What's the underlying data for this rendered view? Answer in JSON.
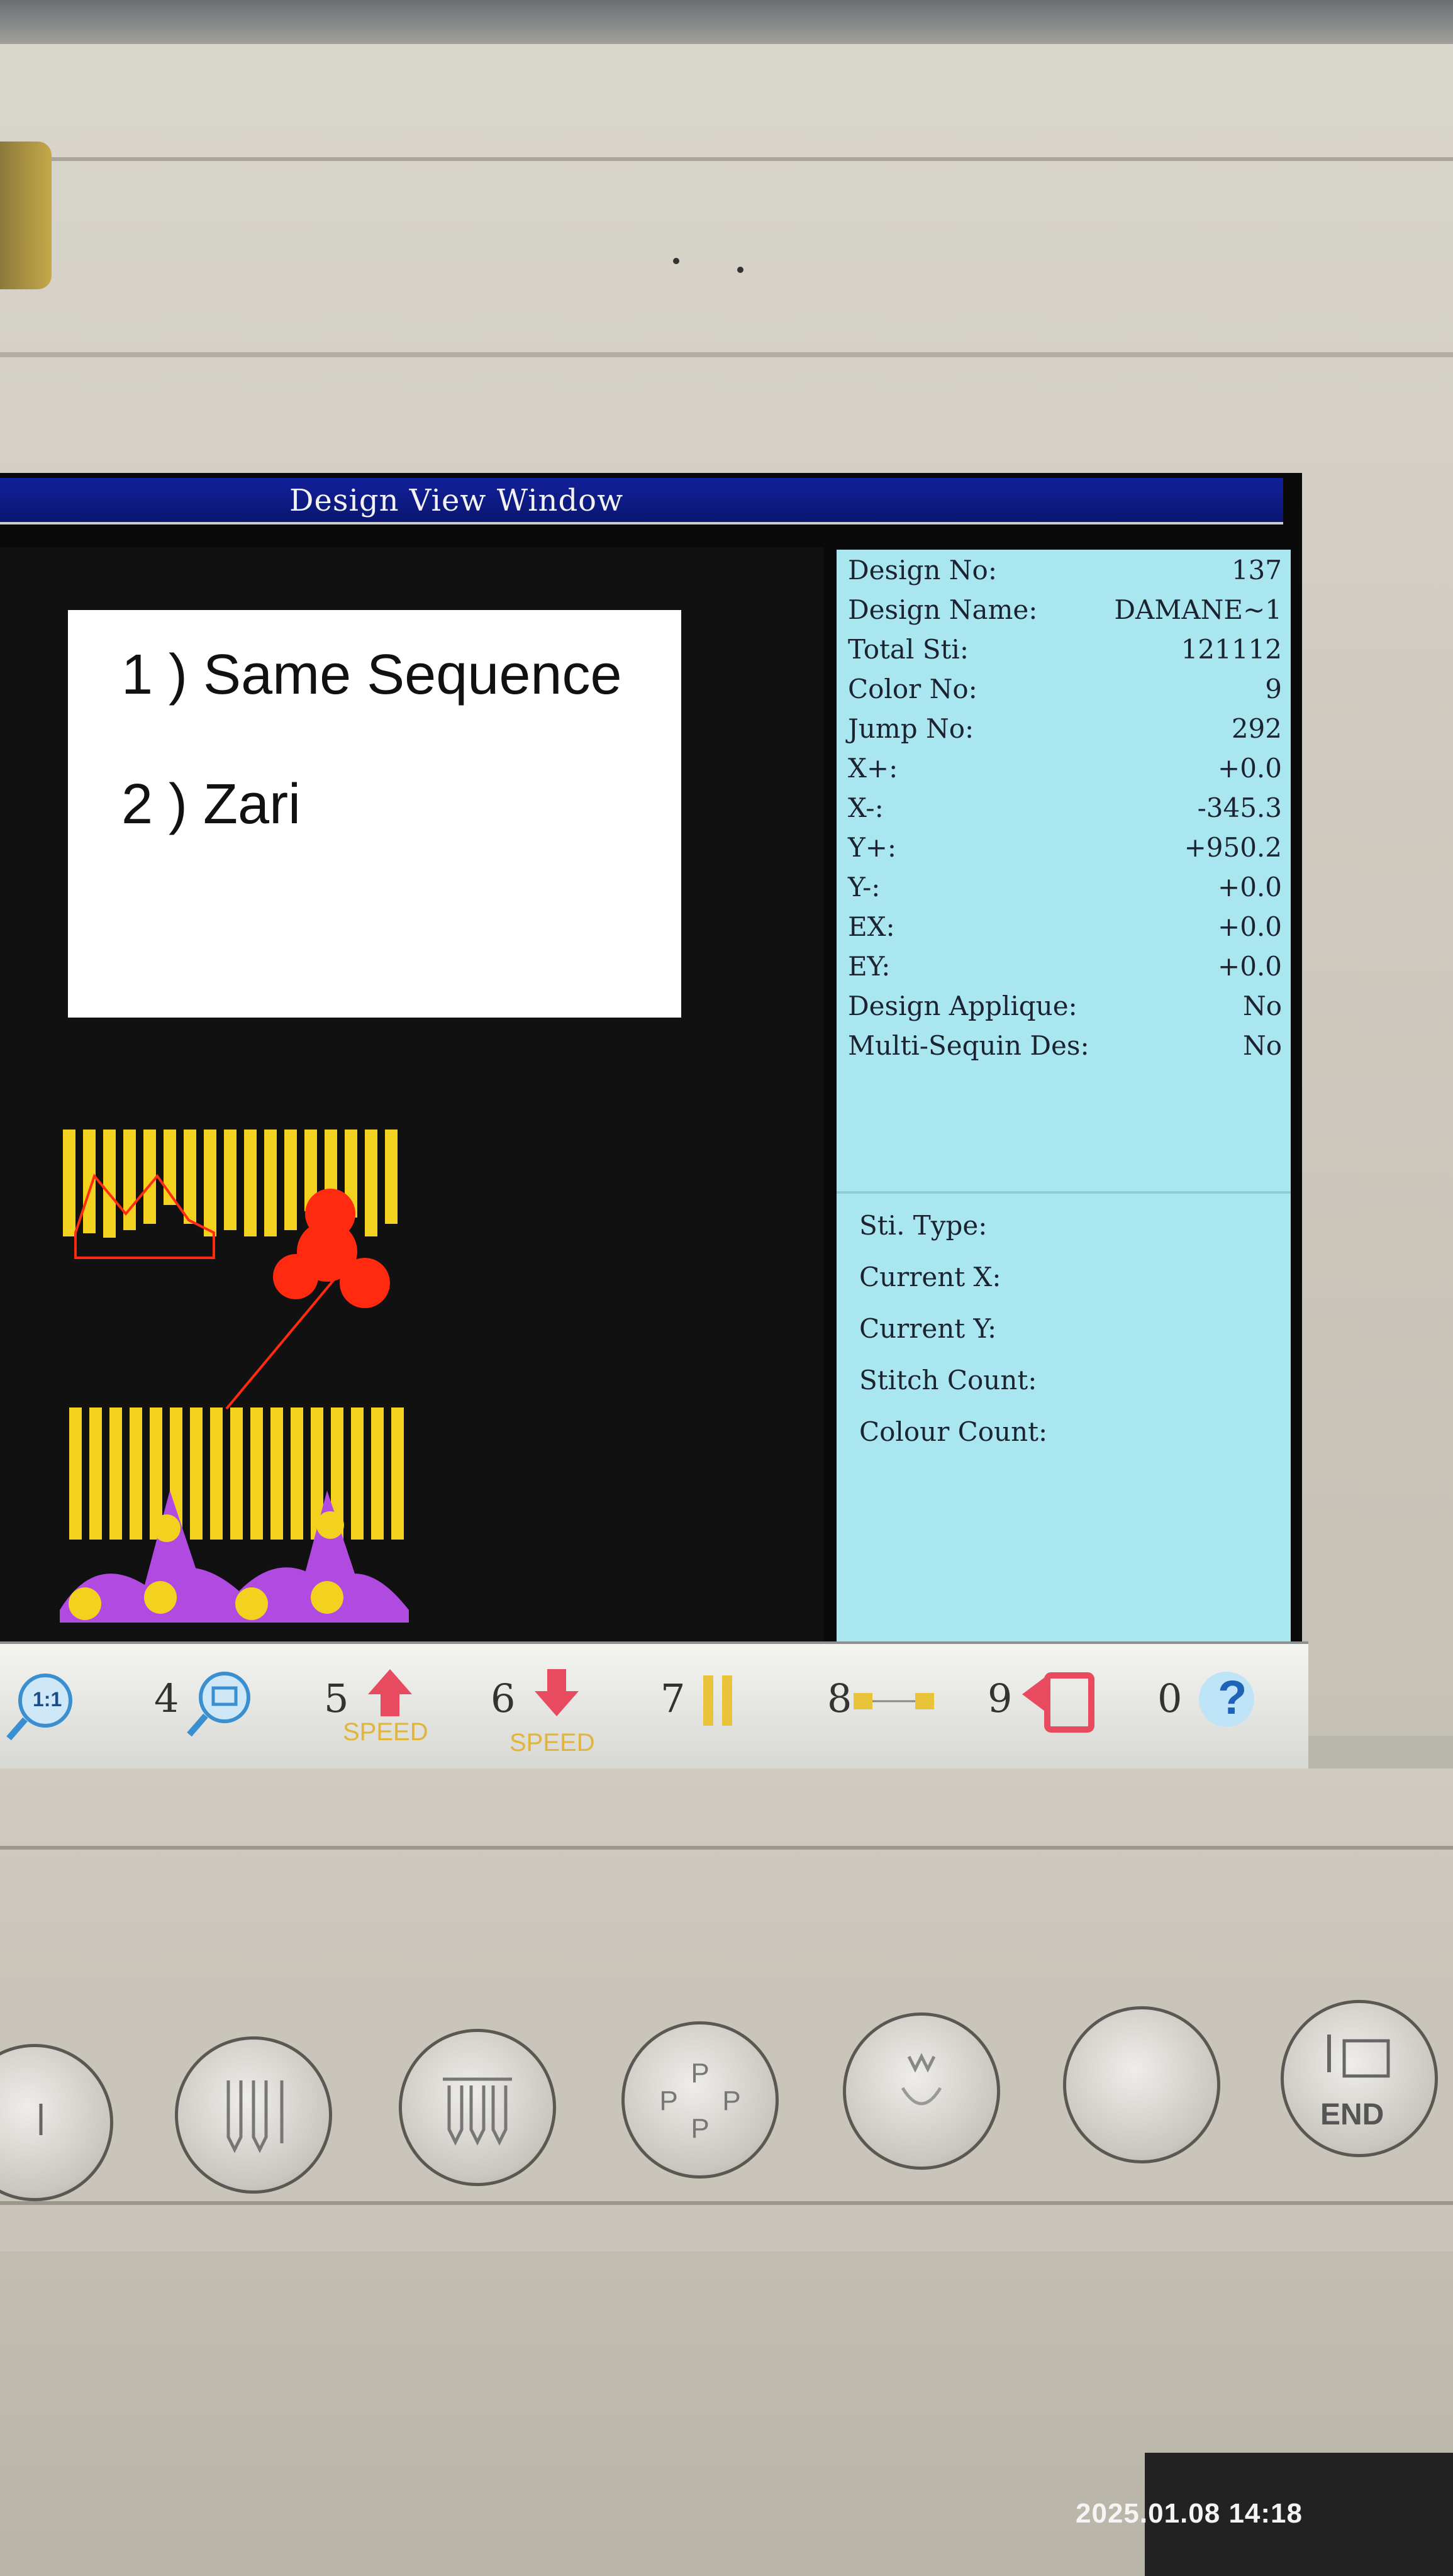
{
  "window": {
    "title": "Design View Window"
  },
  "overlay_note": {
    "lines": [
      "1 ) Same Sequence",
      "2 ) Zari"
    ]
  },
  "design_info": [
    {
      "label": "Design No:",
      "value": "137"
    },
    {
      "label": "Design Name:",
      "value": "DAMANE~1"
    },
    {
      "label": "Total Sti:",
      "value": "121112"
    },
    {
      "label": "Color No:",
      "value": "9"
    },
    {
      "label": "Jump No:",
      "value": "292"
    },
    {
      "label": "X+:",
      "value": "+0.0"
    },
    {
      "label": "X-:",
      "value": "-345.3"
    },
    {
      "label": "Y+:",
      "value": "+950.2"
    },
    {
      "label": "Y-:",
      "value": "+0.0"
    },
    {
      "label": "EX:",
      "value": "+0.0"
    },
    {
      "label": "EY:",
      "value": "+0.0"
    },
    {
      "label": "Design Applique:",
      "value": "No"
    },
    {
      "label": "Multi-Sequin Des:",
      "value": "No"
    }
  ],
  "stitch_status": {
    "sti_type": "Sti. Type:",
    "current_x": "Current X:",
    "current_y": "Current Y:",
    "stitch_count": "Stitch Count:",
    "colour_count": "Colour Count:"
  },
  "function_keys": [
    {
      "num": "",
      "icon": "zoom-1to1-icon",
      "label": "1:1"
    },
    {
      "num": "4",
      "icon": "zoom-window-icon"
    },
    {
      "num": "5",
      "icon": "speed-up-icon",
      "label": "SPEED"
    },
    {
      "num": "6",
      "icon": "speed-down-icon",
      "label": "SPEED"
    },
    {
      "num": "7",
      "icon": "pause-icon"
    },
    {
      "num": "8",
      "icon": "trace-frame-icon"
    },
    {
      "num": "9",
      "icon": "return-icon"
    },
    {
      "num": "0",
      "icon": "help-icon",
      "label": "?"
    }
  ],
  "hardware_buttons": [
    {
      "icon": "needle-single-icon"
    },
    {
      "icon": "needle-select-icon"
    },
    {
      "icon": "needle-row-icon"
    },
    {
      "icon": "frame-rotate-icon"
    },
    {
      "icon": "presser-foot-icon"
    },
    {
      "icon": "blank-button-icon"
    },
    {
      "icon": "end-icon",
      "label": "END"
    }
  ],
  "photo_timestamp": "2025.01.08 14:18",
  "colors": {
    "title_bar": "#0a1670",
    "info_panel": "#a9e6ef",
    "zari": "#f2d21e",
    "motif_red": "#ff2a10",
    "motif_purple": "#b04ae0"
  }
}
